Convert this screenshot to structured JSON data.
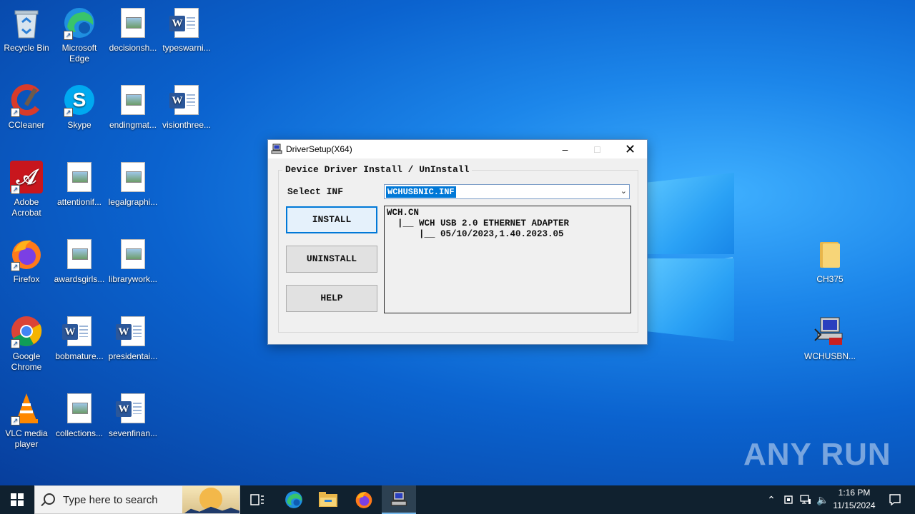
{
  "desktop": {
    "icons_left": [
      {
        "label": "Recycle Bin",
        "type": "recycle-bin"
      },
      {
        "label": "Microsoft Edge",
        "type": "edge"
      },
      {
        "label": "decisionsh...",
        "type": "image-doc"
      },
      {
        "label": "typeswarni...",
        "type": "word-doc"
      },
      {
        "label": "CCleaner",
        "type": "ccleaner"
      },
      {
        "label": "Skype",
        "type": "skype"
      },
      {
        "label": "endingmat...",
        "type": "image-doc"
      },
      {
        "label": "visionthree...",
        "type": "word-doc"
      },
      {
        "label": "Adobe Acrobat",
        "type": "acrobat"
      },
      {
        "label": "attentionif...",
        "type": "image-doc"
      },
      {
        "label": "legalgraphi...",
        "type": "image-doc"
      },
      {
        "label": "Firefox",
        "type": "firefox"
      },
      {
        "label": "awardsgirls...",
        "type": "image-doc"
      },
      {
        "label": "librarywork...",
        "type": "image-doc"
      },
      {
        "label": "Google Chrome",
        "type": "chrome"
      },
      {
        "label": "bobmature...",
        "type": "word-doc"
      },
      {
        "label": "presidentai...",
        "type": "word-doc"
      },
      {
        "label": "VLC media player",
        "type": "vlc"
      },
      {
        "label": "collections...",
        "type": "image-doc"
      },
      {
        "label": "sevenfinan...",
        "type": "word-doc"
      }
    ],
    "icons_right": [
      {
        "label": "CH375",
        "type": "folder"
      },
      {
        "label": "WCHUSBN...",
        "type": "setup-exe"
      }
    ],
    "watermark": "ANY RUN"
  },
  "dialog": {
    "title": "DriverSetup(X64)",
    "group_title": "Device Driver Install / UnInstall",
    "select_label": "Select INF",
    "select_value": "WCHUSBNIC.INF",
    "buttons": {
      "install": "INSTALL",
      "uninstall": "UNINSTALL",
      "help": "HELP"
    },
    "info_lines": [
      "WCH.CN",
      "  |__ WCH USB 2.0 ETHERNET ADAPTER",
      "      |__ 05/10/2023,1.40.2023.05"
    ]
  },
  "taskbar": {
    "search_placeholder": "Type here to search",
    "time": "1:16 PM",
    "date": "11/15/2024",
    "pinned": [
      "task-view-icon",
      "edge-icon",
      "file-explorer-icon",
      "firefox-icon",
      "driversetup-icon"
    ]
  },
  "colors": {
    "accent": "#0078d7",
    "taskbar": "#10212f",
    "word_blue": "#2b579a"
  }
}
